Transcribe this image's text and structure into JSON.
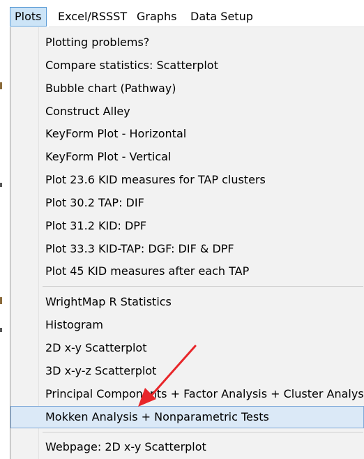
{
  "menubar": {
    "items": [
      {
        "label": "Plots",
        "active": true
      },
      {
        "label": "Excel/RSSST",
        "active": false
      },
      {
        "label": "Graphs",
        "active": false
      },
      {
        "label": "Data Setup",
        "active": false
      }
    ]
  },
  "menu": {
    "groups": [
      {
        "items": [
          "Plotting problems?",
          "Compare statistics: Scatterplot",
          "Bubble chart (Pathway)",
          "Construct Alley",
          "KeyForm Plot - Horizontal",
          "KeyForm Plot - Vertical",
          "Plot 23.6 KID measures for TAP clusters",
          "Plot 30.2 TAP: DIF",
          "Plot 31.2 KID: DPF",
          "Plot 33.3 KID-TAP: DGF: DIF & DPF",
          "Plot 45 KID measures after each TAP"
        ]
      },
      {
        "items": [
          "WrightMap R Statistics",
          "Histogram",
          "2D x-y Scatterplot",
          "3D x-y-z Scatterplot",
          "Principal Components + Factor Analysis + Cluster Analysis",
          "Mokken Analysis + Nonparametric Tests"
        ]
      },
      {
        "items": [
          "Webpage: 2D x-y Scatterplot"
        ]
      }
    ],
    "highlighted_item": "Mokken Analysis + Nonparametric Tests"
  },
  "colors": {
    "menu_background": "#f2f2f2",
    "highlight_fill": "#dbe9f7",
    "highlight_border": "#7fa9d8",
    "active_menubar_fill": "#cce4f7",
    "annotation_arrow": "#e8262a"
  }
}
